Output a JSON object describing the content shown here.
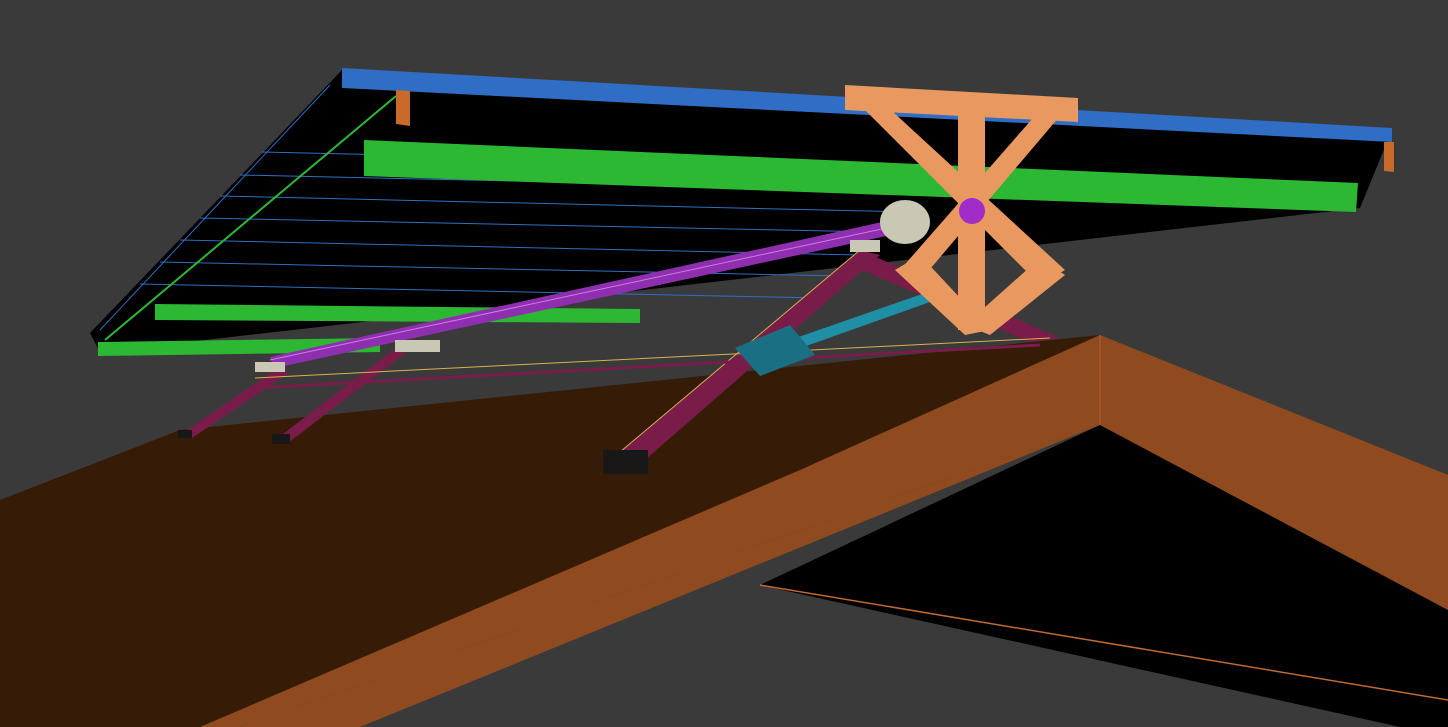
{
  "scene": {
    "background_color": "#3a3a3a",
    "colors": {
      "roof_top_face": "#361b06",
      "roof_front_face": "#8f4b1f",
      "roof_underside": "#000000",
      "panel_top_edge": "#2f6ec4",
      "panel_surface": "#000000",
      "rail": "#2db834",
      "rail_edge": "#8fff8f",
      "end_cap": "#c86a2a",
      "cross_brace": "#e9995f",
      "axle_hub": "#a22cc8",
      "torque_tube": "#8d2fae",
      "strut": "#7a1c4a",
      "strut_edge": "#d8b24a",
      "actuator": "#1f8fa6",
      "actuator_body": "#1b6f82",
      "mount_plate": "#c8c8b4",
      "foot": "#181818"
    },
    "icons": [
      "solar-panel-icon",
      "roof-icon",
      "actuator-icon",
      "cross-brace-icon"
    ]
  }
}
